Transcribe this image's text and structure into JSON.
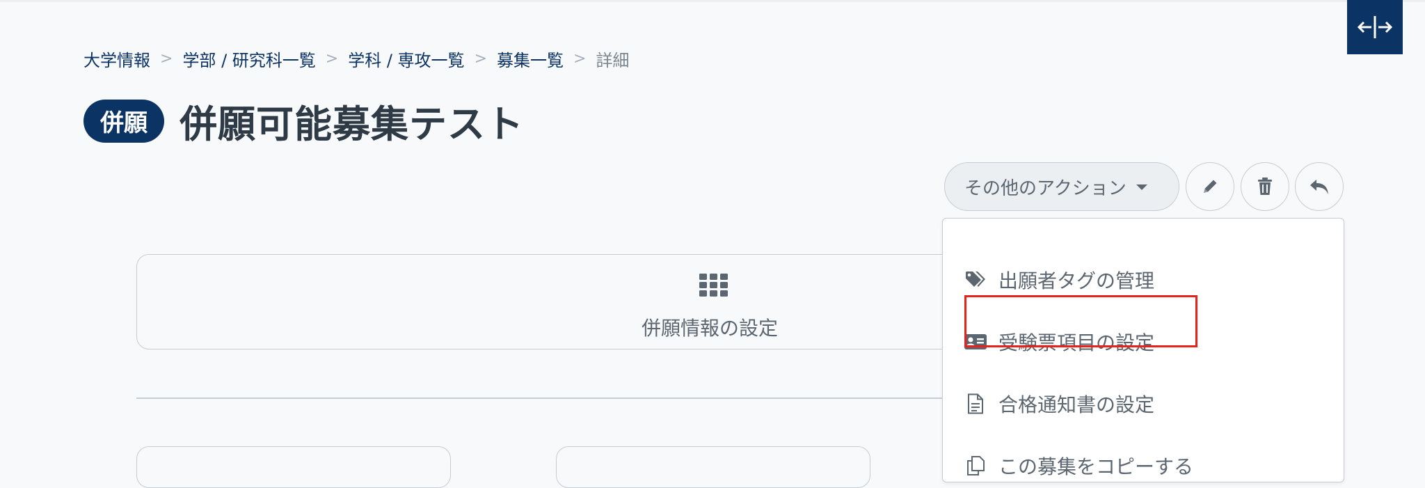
{
  "breadcrumb": {
    "items": [
      "大学情報",
      "学部 / 研究科一覧",
      "学科 / 専攻一覧",
      "募集一覧"
    ],
    "separator": ">",
    "current": "詳細"
  },
  "header": {
    "badge": "併願",
    "title": "併願可能募集テスト"
  },
  "actions": {
    "more_label": "その他のアクション",
    "edit_icon": "pencil-icon",
    "delete_icon": "trash-icon",
    "back_icon": "undo-arrow-icon"
  },
  "card": {
    "icon": "grid-icon",
    "label": "併願情報の設定"
  },
  "dropdown": {
    "items": [
      {
        "icon": "tags-icon",
        "label": "出願者タグの管理"
      },
      {
        "icon": "id-card-icon",
        "label": "受験票項目の設定"
      },
      {
        "icon": "document-icon",
        "label": "合格通知書の設定"
      },
      {
        "icon": "copy-icon",
        "label": "この募集をコピーする"
      }
    ]
  },
  "colors": {
    "brand": "#0b3364",
    "highlight": "#e8221b",
    "muted_text": "#5b6670"
  }
}
